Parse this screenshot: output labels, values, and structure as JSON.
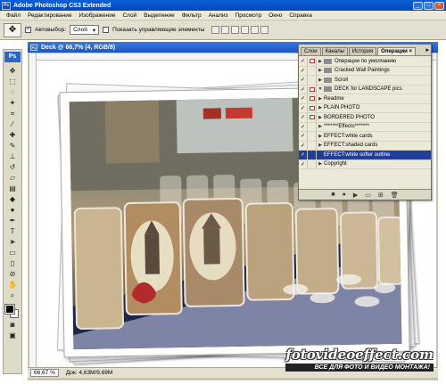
{
  "window": {
    "title": "Adobe Photoshop CS3 Extended"
  },
  "menu": [
    "Файл",
    "Редактирование",
    "Изображение",
    "Слой",
    "Выделение",
    "Фильтр",
    "Анализ",
    "Просмотр",
    "Окно",
    "Справка"
  ],
  "options": {
    "autoselect_label": "Автовыбор:",
    "autoselect_value": "Слой",
    "show_controls_label": "Показать управляющие элементы"
  },
  "document": {
    "title": "Deck @ 66,7% (4, RGB/8)",
    "zoom": "66,67 %",
    "doc_size": "Док: 4,63М/9,69М"
  },
  "toolbox": {
    "logo": "Ps"
  },
  "actions_panel": {
    "tabs": [
      "Слои",
      "Каналы",
      "История",
      "Операции ×"
    ],
    "active_tab": 3,
    "rows": [
      {
        "check": "✓",
        "dialog": true,
        "expand": "▶",
        "folder": true,
        "label": "Операции по умолчанию"
      },
      {
        "check": "✓",
        "dialog": false,
        "expand": "▶",
        "folder": true,
        "label": "Cracked Wall Paintings"
      },
      {
        "check": "✓",
        "dialog": false,
        "expand": "▶",
        "folder": true,
        "label": "Scroll"
      },
      {
        "check": "✓",
        "dialog": true,
        "expand": "▼",
        "folder": true,
        "label": "DECK for LANDSCAPE pics"
      },
      {
        "check": "✓",
        "dialog": true,
        "expand": "▶",
        "folder": false,
        "label": "Readme"
      },
      {
        "check": "✓",
        "dialog": true,
        "expand": "▶",
        "folder": false,
        "label": "PLAIN PHOTO"
      },
      {
        "check": "✓",
        "dialog": true,
        "expand": "▶",
        "folder": false,
        "label": "BORDERED PHOTO"
      },
      {
        "check": "✓",
        "dialog": false,
        "expand": "▶",
        "folder": false,
        "label": "*******Effects*******"
      },
      {
        "check": "✓",
        "dialog": false,
        "expand": "▶",
        "folder": false,
        "label": "EFFECT:white cards"
      },
      {
        "check": "✓",
        "dialog": false,
        "expand": "▶",
        "folder": false,
        "label": "EFFECT:shaded cards"
      },
      {
        "check": "✓",
        "dialog": false,
        "expand": "▶",
        "folder": false,
        "label": "EFFECT:white softer outline",
        "selected": true
      },
      {
        "check": "✓",
        "dialog": false,
        "expand": "▶",
        "folder": false,
        "label": "Copyright"
      }
    ]
  },
  "watermark": {
    "site": "fotovideoeffect.com",
    "tagline": "ВСЕ ДЛЯ ФОТО И ВИДЕО МОНТАЖА!"
  }
}
